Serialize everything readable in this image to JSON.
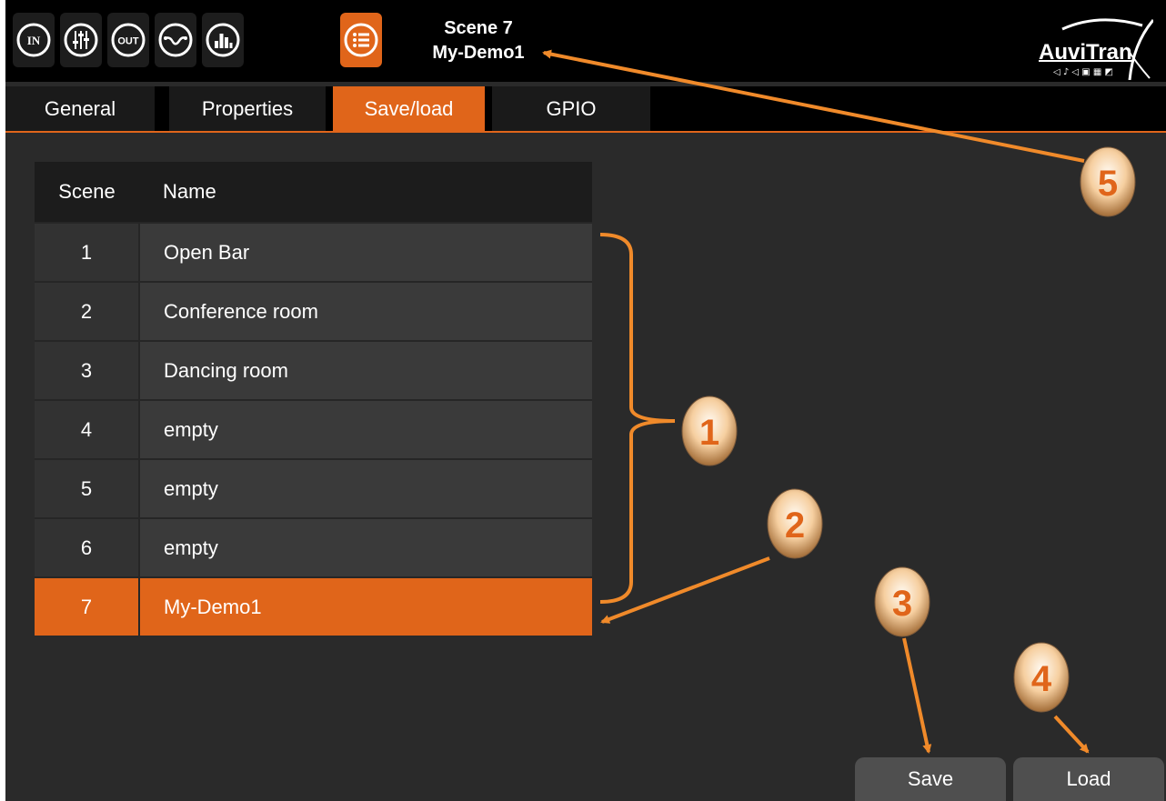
{
  "toolbar": {
    "icons": [
      "in-icon",
      "mixer-faders-icon",
      "out-icon",
      "eq-curve-icon",
      "meter-bars-icon",
      "list-icon"
    ],
    "labels": {
      "in": "IN",
      "out": "OUT"
    }
  },
  "header": {
    "scene_line": "Scene 7",
    "scene_name": "My-Demo1"
  },
  "brand": {
    "name": "AuviTran"
  },
  "tabs": [
    {
      "label": "General",
      "active": false
    },
    {
      "label": "Properties",
      "active": false
    },
    {
      "label": "Save/load",
      "active": true
    },
    {
      "label": "GPIO",
      "active": false
    }
  ],
  "table": {
    "headers": [
      "Scene",
      "Name"
    ],
    "rows": [
      {
        "scene": "1",
        "name": "Open Bar"
      },
      {
        "scene": "2",
        "name": "Conference room"
      },
      {
        "scene": "3",
        "name": "Dancing room"
      },
      {
        "scene": "4",
        "name": "empty"
      },
      {
        "scene": "5",
        "name": "empty"
      },
      {
        "scene": "6",
        "name": "empty"
      },
      {
        "scene": "7",
        "name": "My-Demo1",
        "selected": true
      }
    ]
  },
  "buttons": {
    "save": "Save",
    "load": "Load"
  },
  "callouts": [
    "1",
    "2",
    "3",
    "4",
    "5"
  ],
  "colors": {
    "accent": "#e0651a",
    "background": "#2a2a2a",
    "topbar": "#000000"
  }
}
